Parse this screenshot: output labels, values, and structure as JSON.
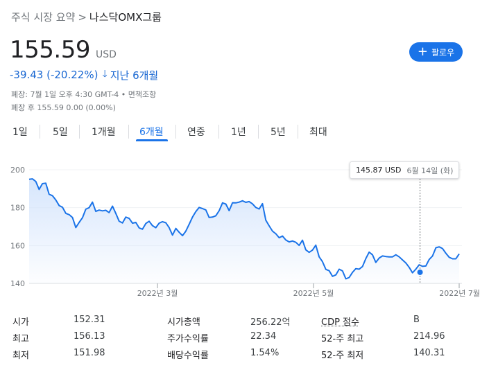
{
  "breadcrumb": {
    "parent": "주식 시장 요약",
    "separator": ">",
    "current": "나스닥OMX그룹"
  },
  "quote": {
    "price": "155.59",
    "currency": "USD",
    "change": "-39.43 (-20.22%)",
    "change_period": "지난 6개월",
    "change_color": "#1967d2",
    "close_time": "폐장: 7월 1일 오후 4:30 GMT-4 •",
    "disclaimer": "면책조항",
    "after_hours": "폐장 후 155.59 0.00 (0.00%)"
  },
  "follow_button": {
    "label": "팔로우",
    "icon": "plus-icon",
    "color": "#1a73e8"
  },
  "tabs": [
    {
      "label": "1일",
      "active": false
    },
    {
      "label": "5일",
      "active": false
    },
    {
      "label": "1개월",
      "active": false
    },
    {
      "label": "6개월",
      "active": true
    },
    {
      "label": "연중",
      "active": false
    },
    {
      "label": "1년",
      "active": false
    },
    {
      "label": "5년",
      "active": false
    },
    {
      "label": "최대",
      "active": false
    }
  ],
  "tooltip": {
    "price": "145.87 USD",
    "date": "6월 14일 (화)"
  },
  "chart_data": {
    "type": "area",
    "x_tick_labels": [
      "2022년 3월",
      "2022년 5월",
      "2022년 7월"
    ],
    "x_tick_positions": [
      0.2985,
      0.6613,
      1.0
    ],
    "y_ticks": [
      140,
      160,
      180,
      200
    ],
    "ylim": [
      140,
      200
    ],
    "grid": true,
    "line_color": "#1a73e8",
    "fill_color": "#d2e3fc",
    "highlight": {
      "price": 145.87,
      "date": "6월 14일 (화)",
      "x": 0.909
    },
    "series": [
      {
        "values": [
          195.0,
          195.2,
          193.8,
          189.6,
          192.7,
          192.9,
          187.1,
          186.3,
          184.1,
          181.1,
          180.2,
          177.0,
          176.3,
          174.8,
          169.5,
          172.2,
          174.7,
          179.2,
          180.0,
          182.9,
          178.0,
          178.7,
          178.3,
          178.6,
          177.4,
          180.8,
          176.9,
          172.8,
          171.9,
          175.0,
          174.3,
          171.8,
          172.2,
          169.3,
          168.6,
          171.6,
          172.8,
          170.5,
          169.4,
          171.8,
          172.6,
          172.0,
          169.4,
          165.5,
          169.0,
          167.0,
          165.2,
          167.6,
          171.2,
          175.0,
          177.9,
          180.1,
          179.5,
          178.8,
          174.8,
          175.0,
          175.7,
          178.4,
          182.5,
          181.9,
          178.4,
          182.6,
          182.5,
          182.9,
          183.6,
          182.8,
          183.2,
          182.0,
          180.1,
          179.3,
          182.1,
          173.4,
          170.4,
          167.6,
          166.2,
          164.1,
          165.0,
          162.9,
          161.9,
          162.4,
          161.7,
          160.1,
          162.8,
          157.7,
          156.4,
          157.6,
          160.2,
          154.0,
          151.5,
          147.4,
          146.7,
          143.7,
          144.5,
          147.5,
          146.6,
          142.4,
          143.1,
          145.8,
          147.8,
          147.5,
          148.9,
          153.1,
          156.5,
          155.1,
          151.1,
          153.4,
          154.5,
          154.2,
          154.0,
          154.0,
          155.1,
          154.0,
          152.4,
          150.8,
          148.5,
          145.6,
          147.5,
          149.8,
          149.0,
          149.2,
          152.6,
          154.5,
          158.8,
          159.3,
          158.4,
          155.9,
          153.8,
          153.0,
          153.0,
          155.6
        ]
      }
    ]
  },
  "stats": [
    [
      {
        "label": "시가",
        "value": "152.31"
      },
      {
        "label": "시가총액",
        "value": "256.22억"
      },
      {
        "label": "CDP 점수",
        "value": "B"
      }
    ],
    [
      {
        "label": "최고",
        "value": "156.13"
      },
      {
        "label": "주가수익률",
        "value": "22.34"
      },
      {
        "label": "52-주 최고",
        "value": "214.96"
      }
    ],
    [
      {
        "label": "최저",
        "value": "151.98"
      },
      {
        "label": "배당수익률",
        "value": "1.54%"
      },
      {
        "label": "52-주 최저",
        "value": "140.31"
      }
    ]
  ]
}
